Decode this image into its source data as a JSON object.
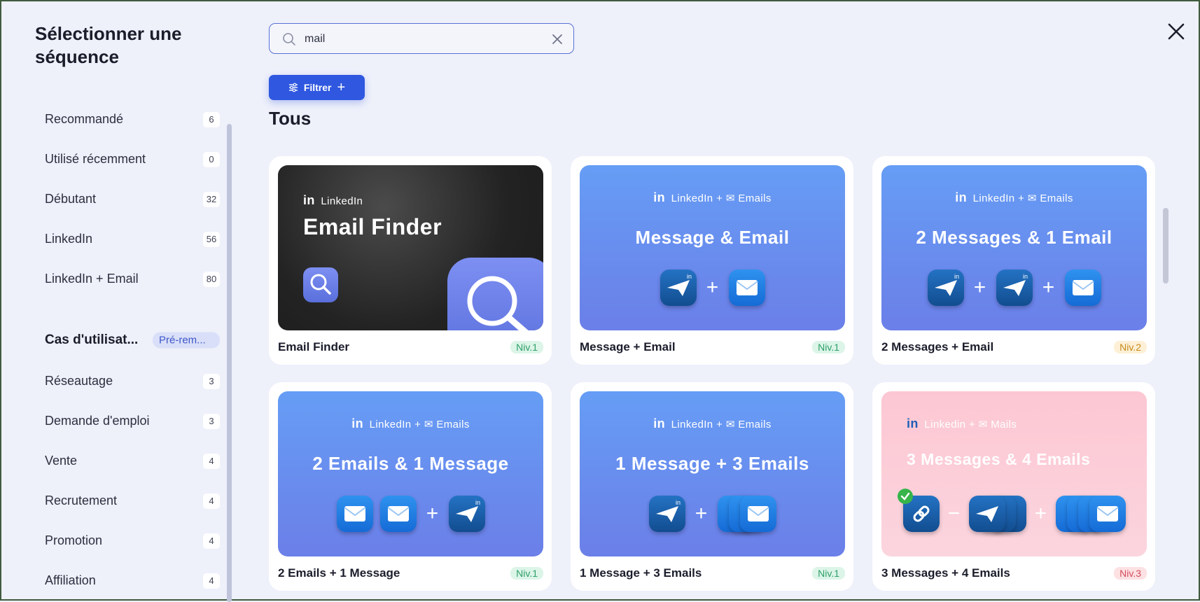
{
  "sidebar": {
    "title": "Sélectionner une séquence",
    "items": [
      {
        "label": "Recommandé",
        "count": "6"
      },
      {
        "label": "Utilisé récemment",
        "count": "0"
      },
      {
        "label": "Débutant",
        "count": "32"
      },
      {
        "label": "LinkedIn",
        "count": "56"
      },
      {
        "label": "LinkedIn + Email",
        "count": "80"
      }
    ],
    "section": {
      "label": "Cas d'utilisat...",
      "pill": "Pré-rem..."
    },
    "use_cases": [
      {
        "label": "Réseautage",
        "count": "3"
      },
      {
        "label": "Demande d'emploi",
        "count": "3"
      },
      {
        "label": "Vente",
        "count": "4"
      },
      {
        "label": "Recrutement",
        "count": "4"
      },
      {
        "label": "Promotion",
        "count": "4"
      },
      {
        "label": "Affiliation",
        "count": "4"
      }
    ]
  },
  "search": {
    "value": "mail",
    "icon": "search-icon",
    "clear_icon": "close-icon"
  },
  "filter": {
    "label": "Filtrer",
    "plus": "+"
  },
  "section_title": "Tous",
  "close_icon": "close-icon",
  "colors": {
    "accent": "#2f57e0",
    "background": "#eef0fa"
  },
  "cards": [
    {
      "name": "Email Finder",
      "level": "Niv.1",
      "tag_in": "in",
      "tag": "LinkedIn",
      "headline": "Email Finder"
    },
    {
      "name": "Message + Email",
      "level": "Niv.1",
      "tag_in": "in",
      "tag": "LinkedIn + ✉ Emails",
      "headline": "Message & Email"
    },
    {
      "name": "2 Messages + Email",
      "level": "Niv.2",
      "tag_in": "in",
      "tag": "LinkedIn + ✉ Emails",
      "headline": "2 Messages & 1 Email"
    },
    {
      "name": "2 Emails + 1 Message",
      "level": "Niv.1",
      "tag_in": "in",
      "tag": "LinkedIn + ✉ Emails",
      "headline": "2 Emails & 1 Message"
    },
    {
      "name": "1 Message + 3 Emails",
      "level": "Niv.1",
      "tag_in": "in",
      "tag": "LinkedIn + ✉ Emails",
      "headline": "1 Message + 3 Emails"
    },
    {
      "name": "3 Messages + 4 Emails",
      "level": "Niv.3",
      "tag_in": "in",
      "tag": "Linkedin + ✉ Mails",
      "headline": "3 Messages & 4 Emails"
    }
  ],
  "operators": {
    "plus": "+",
    "minus": "−"
  }
}
